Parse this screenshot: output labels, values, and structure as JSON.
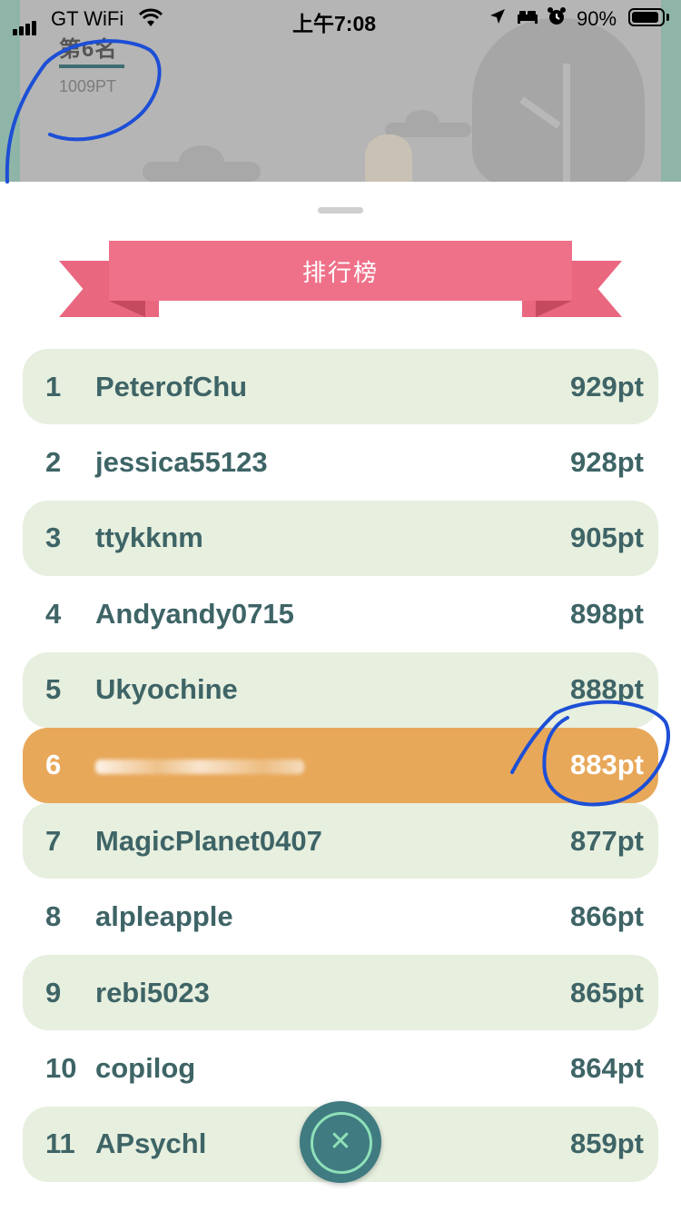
{
  "status_bar": {
    "carrier": "GT WiFi",
    "time": "上午7:08",
    "battery": "90%",
    "battery_level": 0.9,
    "icons": [
      "signal-icon",
      "wifi-icon",
      "location-icon",
      "bed-icon",
      "alarm-icon",
      "battery-icon"
    ]
  },
  "header": {
    "rank_label": "第6名",
    "rank_points": "1009PT"
  },
  "sheet": {
    "title": "排行榜"
  },
  "leaderboard": [
    {
      "rank": "1",
      "name": "PeterofChu",
      "points": "929pt"
    },
    {
      "rank": "2",
      "name": "jessica55123",
      "points": "928pt"
    },
    {
      "rank": "3",
      "name": "ttykknm",
      "points": "905pt"
    },
    {
      "rank": "4",
      "name": "Andyandy0715",
      "points": "898pt"
    },
    {
      "rank": "5",
      "name": "Ukyochine",
      "points": "888pt"
    },
    {
      "rank": "6",
      "name": "",
      "points": "883pt"
    },
    {
      "rank": "7",
      "name": "MagicPlanet0407",
      "points": "877pt"
    },
    {
      "rank": "8",
      "name": "alpleapple",
      "points": "866pt"
    },
    {
      "rank": "9",
      "name": "rebi5023",
      "points": "865pt"
    },
    {
      "rank": "10",
      "name": "copilog",
      "points": "864pt"
    },
    {
      "rank": "11",
      "name": "APsychl",
      "points": "859pt"
    }
  ],
  "colors": {
    "row_alt": "#e7efdf",
    "row_highlight": "#e8a85a",
    "text": "#3e6466",
    "ribbon": "#ef7189",
    "close_button": "#3f7b80",
    "annotation": "#1d4fd6"
  },
  "close_button": {
    "icon": "close-icon",
    "glyph": "✕"
  }
}
